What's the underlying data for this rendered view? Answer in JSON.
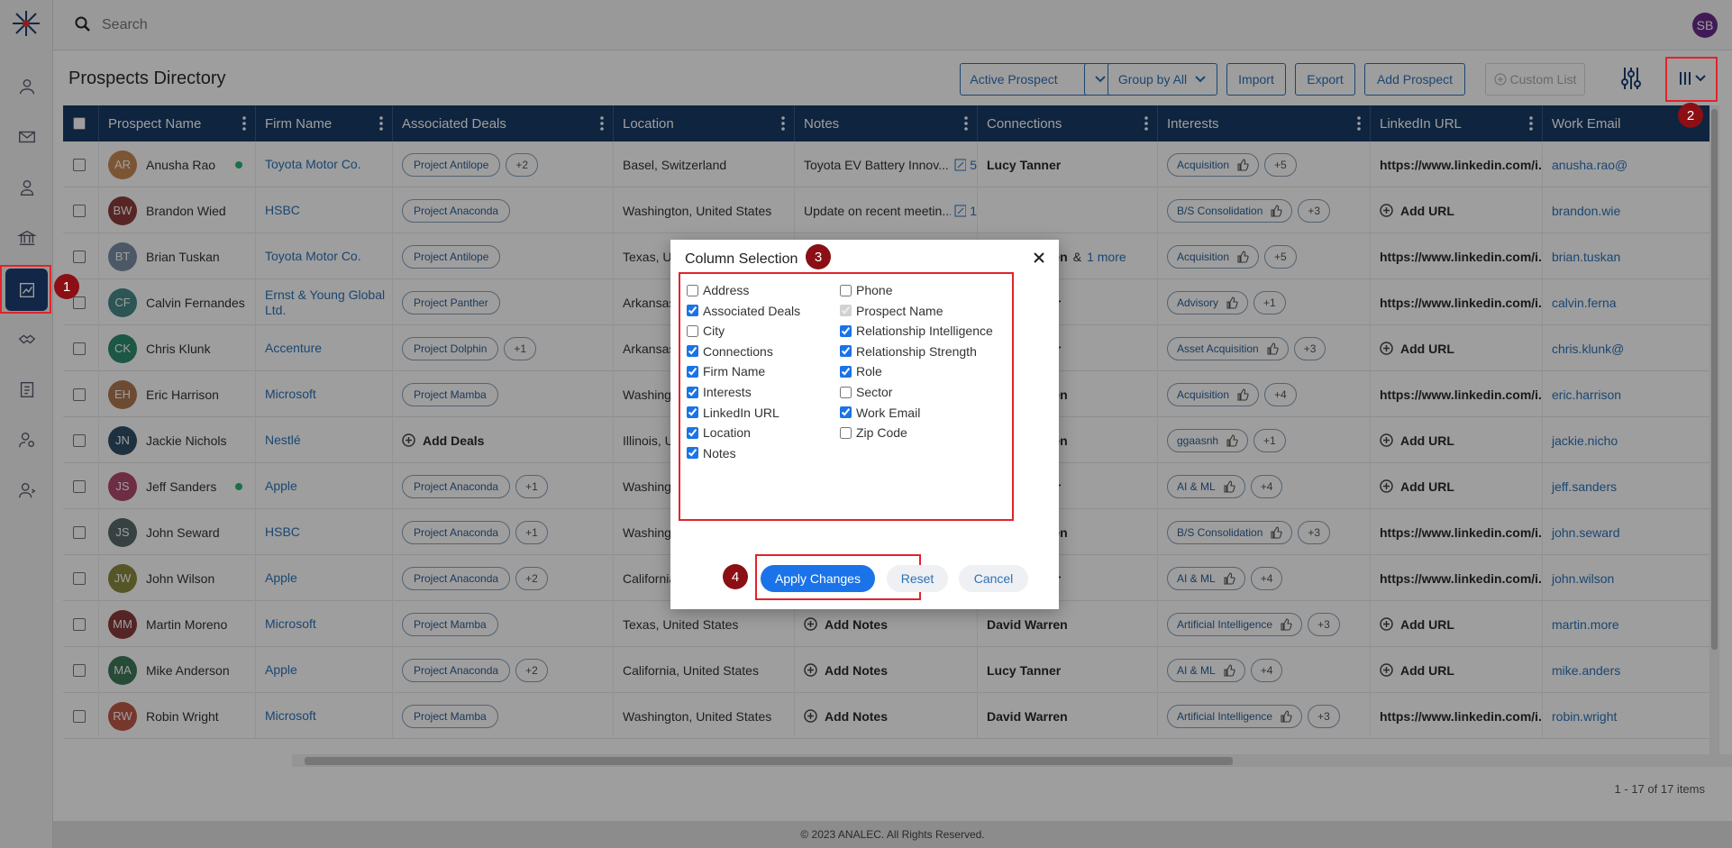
{
  "search": {
    "placeholder": "Search"
  },
  "user": {
    "initials": "SB"
  },
  "page": {
    "title": "Prospects Directory"
  },
  "toolbar": {
    "active_prospect": "Active Prospect",
    "group_by": "Group by All",
    "import": "Import",
    "export": "Export",
    "add_prospect": "Add Prospect",
    "custom_list": "Custom List"
  },
  "columns": [
    "Prospect Name",
    "Firm Name",
    "Associated Deals",
    "Location",
    "Notes",
    "Connections",
    "Interests",
    "LinkedIn URL",
    "Work Email"
  ],
  "rows": [
    {
      "initials": "AR",
      "color": "#c98a56",
      "name": "Anusha Rao",
      "online": true,
      "firm": "Toyota Motor Co.",
      "deal": "Project Antilope",
      "deal_more": "+2",
      "location": "Basel, Switzerland",
      "notes": "Toyota EV Battery Innov...",
      "notes_count": "5",
      "connection": "Lucy Tanner",
      "connection_more": "",
      "interest": "Acquisition",
      "interest_more": "+5",
      "linkedin": "https://www.linkedin.com/i...",
      "email": "anusha.rao@"
    },
    {
      "initials": "BW",
      "color": "#8e3d3d",
      "name": "Brandon Wied",
      "online": false,
      "firm": "HSBC",
      "deal": "Project Anaconda",
      "deal_more": "",
      "location": "Washington, United States",
      "notes": "Update on recent meetin...",
      "notes_count": "1",
      "connection": "",
      "connection_more": "",
      "interest": "B/S Consolidation",
      "interest_more": "+3",
      "linkedin": "Add URL",
      "email": "brandon.wie"
    },
    {
      "initials": "BT",
      "color": "#7c8fa6",
      "name": "Brian Tuskan",
      "online": false,
      "firm": "Toyota Motor Co.",
      "deal": "Project Antilope",
      "deal_more": "",
      "location": "Texas, United States",
      "notes": "",
      "notes_count": "",
      "connection": "David Warren",
      "connection_more": "1 more",
      "interest": "Acquisition",
      "interest_more": "+5",
      "linkedin": "https://www.linkedin.com/i...",
      "email": "brian.tuskan"
    },
    {
      "initials": "CF",
      "color": "#4a8a8c",
      "name": "Calvin Fernandes",
      "online": false,
      "firm": "Ernst & Young Global Ltd.",
      "deal": "Project Panther",
      "deal_more": "",
      "location": "Arkansas, United States",
      "notes": "",
      "notes_count": "",
      "connection": "Lucy Tanner",
      "connection_more": "",
      "interest": "Advisory",
      "interest_more": "+1",
      "linkedin": "https://www.linkedin.com/i...",
      "email": "calvin.ferna"
    },
    {
      "initials": "CK",
      "color": "#2e8c6e",
      "name": "Chris Klunk",
      "online": false,
      "firm": "Accenture",
      "deal": "Project Dolphin",
      "deal_more": "+1",
      "location": "Arkansas, United States",
      "notes": "",
      "notes_count": "",
      "connection": "Lucy Tanner",
      "connection_more": "",
      "interest": "Asset Acquisition",
      "interest_more": "+3",
      "linkedin": "Add URL",
      "email": "chris.klunk@"
    },
    {
      "initials": "EH",
      "color": "#b07a52",
      "name": "Eric Harrison",
      "online": false,
      "firm": "Microsoft",
      "deal": "Project Mamba",
      "deal_more": "",
      "location": "Washington, United States",
      "notes": "",
      "notes_count": "",
      "connection": "David Warren",
      "connection_more": "",
      "interest": "Acquisition",
      "interest_more": "+4",
      "linkedin": "https://www.linkedin.com/i...",
      "email": "eric.harrison"
    },
    {
      "initials": "JN",
      "color": "#2f4f6a",
      "name": "Jackie Nichols",
      "online": false,
      "firm": "Nestlé",
      "deal": "Add Deals",
      "deal_more": "",
      "location": "Illinois, United States",
      "notes": "",
      "notes_count": "",
      "connection": "David Warren",
      "connection_more": "",
      "interest": "ggaasnh",
      "interest_more": "+1",
      "linkedin": "Add URL",
      "email": "jackie.nicho"
    },
    {
      "initials": "JS",
      "color": "#b04a6e",
      "name": "Jeff Sanders",
      "online": true,
      "firm": "Apple",
      "deal": "Project Anaconda",
      "deal_more": "+1",
      "location": "Washington, United States",
      "notes": "",
      "notes_count": "",
      "connection": "Lucy Tanner",
      "connection_more": "",
      "interest": "AI & ML",
      "interest_more": "+4",
      "linkedin": "Add URL",
      "email": "jeff.sanders"
    },
    {
      "initials": "JS",
      "color": "#5a6a6a",
      "name": "John Seward",
      "online": false,
      "firm": "HSBC",
      "deal": "Project Anaconda",
      "deal_more": "+1",
      "location": "Washington, United States",
      "notes": "",
      "notes_count": "",
      "connection": "David Warren",
      "connection_more": "",
      "interest": "B/S Consolidation",
      "interest_more": "+3",
      "linkedin": "https://www.linkedin.com/i...",
      "email": "john.seward"
    },
    {
      "initials": "JW",
      "color": "#8a8a3e",
      "name": "John Wilson",
      "online": false,
      "firm": "Apple",
      "deal": "Project Anaconda",
      "deal_more": "+2",
      "location": "California, United States",
      "notes": "",
      "notes_count": "",
      "connection": "Lucy Tanner",
      "connection_more": "",
      "interest": "AI & ML",
      "interest_more": "+4",
      "linkedin": "https://www.linkedin.com/i...",
      "email": "john.wilson"
    },
    {
      "initials": "MM",
      "color": "#8a3a3a",
      "name": "Martin Moreno",
      "online": false,
      "firm": "Microsoft",
      "deal": "Project Mamba",
      "deal_more": "",
      "location": "Texas, United States",
      "notes": "Add Notes",
      "notes_count": "",
      "connection": "David Warren",
      "connection_more": "",
      "interest": "Artificial Intelligence",
      "interest_more": "+3",
      "linkedin": "Add URL",
      "email": "martin.more"
    },
    {
      "initials": "MA",
      "color": "#3e7a5a",
      "name": "Mike Anderson",
      "online": false,
      "firm": "Apple",
      "deal": "Project Anaconda",
      "deal_more": "+2",
      "location": "California, United States",
      "notes": "Add Notes",
      "notes_count": "",
      "connection": "Lucy Tanner",
      "connection_more": "",
      "interest": "AI & ML",
      "interest_more": "+4",
      "linkedin": "Add URL",
      "email": "mike.anders"
    },
    {
      "initials": "RW",
      "color": "#c05a4a",
      "name": "Robin Wright",
      "online": false,
      "firm": "Microsoft",
      "deal": "Project Mamba",
      "deal_more": "",
      "location": "Washington, United States",
      "notes": "Add Notes",
      "notes_count": "",
      "connection": "David Warren",
      "connection_more": "",
      "interest": "Artificial Intelligence",
      "interest_more": "+3",
      "linkedin": "https://www.linkedin.com/i...",
      "email": "robin.wright"
    }
  ],
  "pager": {
    "text": "1 - 17 of 17 items"
  },
  "footer": {
    "text": "© 2023 ANALEC. All Rights Reserved."
  },
  "modal": {
    "title": "Column Selection",
    "options_left": [
      {
        "label": "Address",
        "checked": false
      },
      {
        "label": "Associated Deals",
        "checked": true
      },
      {
        "label": "City",
        "checked": false
      },
      {
        "label": "Connections",
        "checked": true
      },
      {
        "label": "Firm Name",
        "checked": true
      },
      {
        "label": "Interests",
        "checked": true
      },
      {
        "label": "LinkedIn URL",
        "checked": true
      },
      {
        "label": "Location",
        "checked": true
      },
      {
        "label": "Notes",
        "checked": true
      }
    ],
    "options_right": [
      {
        "label": "Phone",
        "checked": false
      },
      {
        "label": "Prospect Name",
        "checked": true,
        "disabled": true
      },
      {
        "label": "Relationship Intelligence",
        "checked": true
      },
      {
        "label": "Relationship Strength",
        "checked": true
      },
      {
        "label": "Role",
        "checked": true
      },
      {
        "label": "Sector",
        "checked": false
      },
      {
        "label": "Work Email",
        "checked": true
      },
      {
        "label": "Zip Code",
        "checked": false
      }
    ],
    "apply": "Apply Changes",
    "reset": "Reset",
    "cancel": "Cancel"
  },
  "steps": [
    "1",
    "2",
    "3",
    "4"
  ],
  "colors": {
    "header": "#183a66",
    "accent": "#2d72b8",
    "primary": "#1a73e8",
    "highlight": "#e3232b",
    "step_badge": "#8b0f14"
  }
}
